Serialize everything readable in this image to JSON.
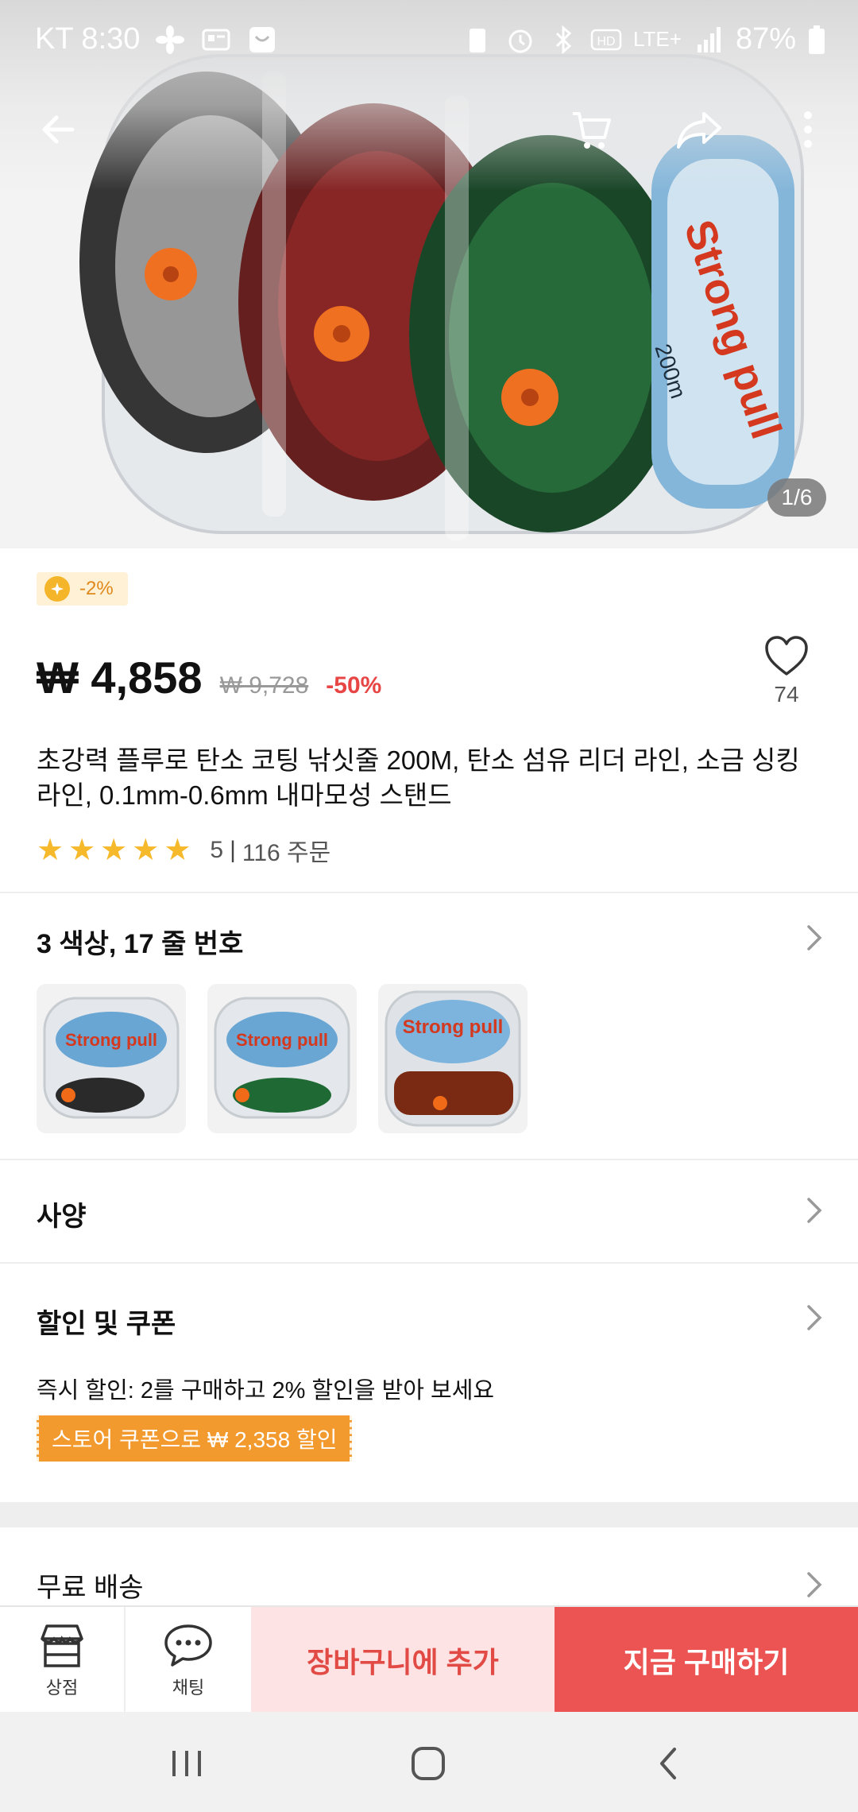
{
  "status_bar": {
    "carrier_time": "KT 8:30",
    "network": "LTE+",
    "battery": "87%"
  },
  "hero": {
    "page_indicator": "1/6",
    "label_text": "Strong pull",
    "length_text": "200m"
  },
  "coins_badge": "-2%",
  "price": {
    "current": "₩ 4,858",
    "original": "₩ 9,728",
    "discount": "-50%"
  },
  "wishlist": {
    "count": "74"
  },
  "product_title": "초강력 플루로 탄소 코팅 낚싯줄 200M, 탄소 섬유 리더 라인, 소금 싱킹 라인, 0.1mm-0.6mm 내마모성 스탠드",
  "rating": {
    "stars": 5,
    "score": "5",
    "orders": "116 주문"
  },
  "variants": {
    "title": "3 색상, 17 줄 번호",
    "thumbnails": [
      "white-green-spool",
      "green-spool",
      "red-spool"
    ]
  },
  "specs": {
    "title": "사양"
  },
  "discounts": {
    "title": "할인 및 쿠폰",
    "instant": "즉시 할인: 2를 구매하고 2% 할인을 받아 보세요",
    "coupon": "스토어 쿠폰으로 ₩ 2,358 할인"
  },
  "shipping": {
    "title": "무료 배송"
  },
  "action_bar": {
    "store_label": "상점",
    "chat_label": "채팅",
    "add_to_cart": "장바구니에 추가",
    "buy_now": "지금 구매하기"
  },
  "colors": {
    "accent_red": "#ec5453",
    "cart_bg": "#fde3e3",
    "coupon_orange": "#f39a2e",
    "star_yellow": "#f6b92b"
  }
}
